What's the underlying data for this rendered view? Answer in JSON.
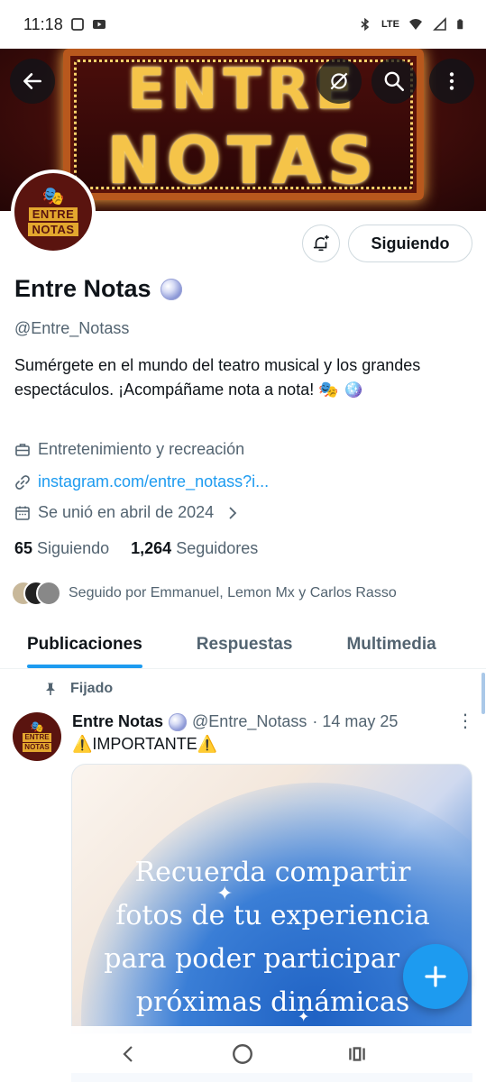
{
  "status_bar": {
    "time": "11:18",
    "network": "LTE"
  },
  "banner": {
    "line1": "ENTRE",
    "line2": "NOTAS"
  },
  "avatar": {
    "text_line1": "ENTRE",
    "text_line2": "NOTAS"
  },
  "profile": {
    "name": "Entre Notas",
    "handle": "@Entre_Notass",
    "bio": "Sumérgete en el mundo del teatro musical y los grandes espectáculos. ¡Acompáñame nota a nota! 🎭 🪩",
    "category": "Entretenimiento y recreación",
    "link": "instagram.com/entre_notass?i...",
    "joined": "Se unió en abril de 2024",
    "following_count": "65",
    "following_label": "Siguiendo",
    "followers_count": "1,264",
    "followers_label": "Seguidores",
    "followed_by": "Seguido por Emmanuel, Lemon Mx y Carlos Rasso",
    "follow_button": "Siguiendo"
  },
  "tabs": [
    {
      "label": "Publicaciones",
      "active": true
    },
    {
      "label": "Respuestas",
      "active": false
    },
    {
      "label": "Multimedia",
      "active": false
    }
  ],
  "post": {
    "pinned_label": "Fijado",
    "author": "Entre Notas",
    "handle": "@Entre_Notass",
    "date": "· 14 may 25",
    "text": "⚠️IMPORTANTE⚠️",
    "image_text": "Recuerda compartir fotos de tu experiencia para poder participar en próximas dinámicas"
  },
  "colors": {
    "accent": "#1d9bf0",
    "text": "#0f1419",
    "muted": "#536471"
  }
}
